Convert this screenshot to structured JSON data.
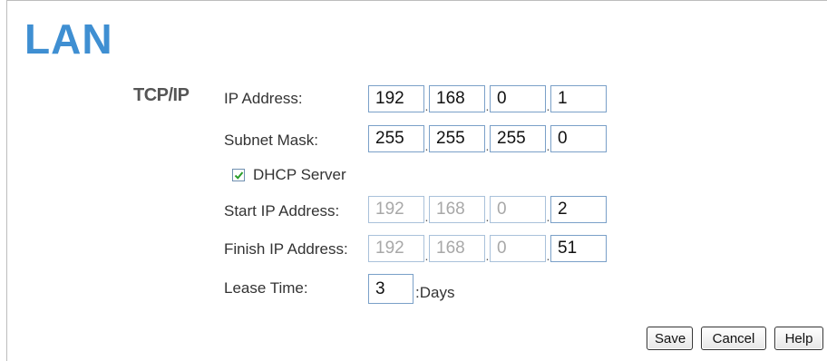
{
  "page": {
    "title": "LAN"
  },
  "tcpip": {
    "section_label": "TCP/IP",
    "ip_address": {
      "label": "IP Address:",
      "octets": [
        "192",
        "168",
        "0",
        "1"
      ]
    },
    "subnet_mask": {
      "label": "Subnet Mask:",
      "octets": [
        "255",
        "255",
        "255",
        "0"
      ]
    }
  },
  "dhcp": {
    "label": "DHCP Server",
    "checked": true,
    "start_ip": {
      "label": "Start IP Address:",
      "octets": [
        "192",
        "168",
        "0",
        "2"
      ]
    },
    "finish_ip": {
      "label": "Finish IP Address:",
      "octets": [
        "192",
        "168",
        "0",
        "51"
      ]
    },
    "lease_time": {
      "label": "Lease Time:",
      "value": "3",
      "unit": ":Days"
    }
  },
  "buttons": {
    "save": "Save",
    "cancel": "Cancel",
    "help": "Help"
  }
}
